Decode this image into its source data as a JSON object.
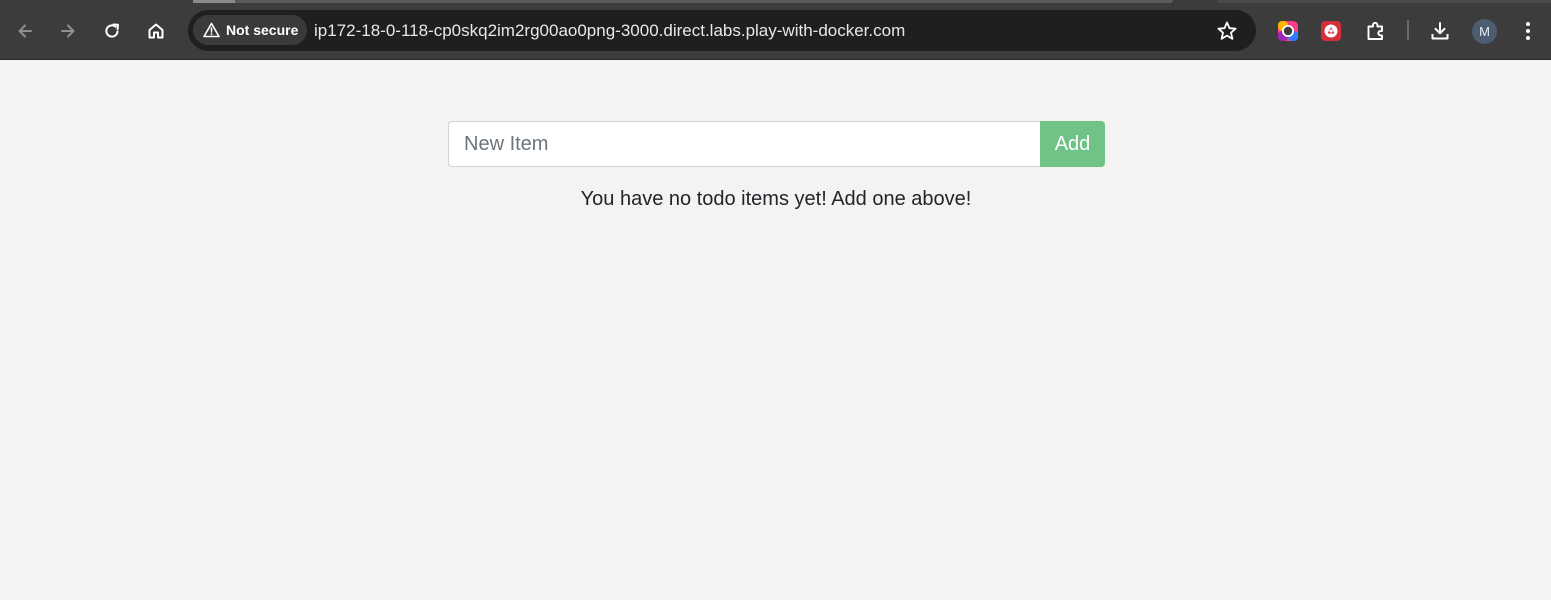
{
  "browser": {
    "security_label": "Not secure",
    "url": "ip172-18-0-118-cp0skq2im2rg00ao0png-3000.direct.labs.play-with-docker.com",
    "profile_initial": "M",
    "icons": {
      "back": "arrow-left-icon",
      "forward": "arrow-right-icon",
      "reload": "reload-icon",
      "home": "home-icon",
      "warning": "warning-triangle-icon",
      "bookmark": "star-icon",
      "extension_color": "color-ring-extension-icon",
      "extension_red": "red-extension-icon",
      "extensions": "puzzle-icon",
      "downloads": "download-icon",
      "menu": "kebab-menu-icon"
    }
  },
  "todo": {
    "input_placeholder": "New Item",
    "input_value": "",
    "add_label": "Add",
    "empty_message": "You have no todo items yet! Add one above!"
  },
  "colors": {
    "chrome_bg": "#3c3c3c",
    "omnibox_bg": "#1f1f1f",
    "page_bg": "#f3f3f3",
    "add_button_bg": "#6fc386",
    "avatar_bg": "#4b5d6e"
  }
}
